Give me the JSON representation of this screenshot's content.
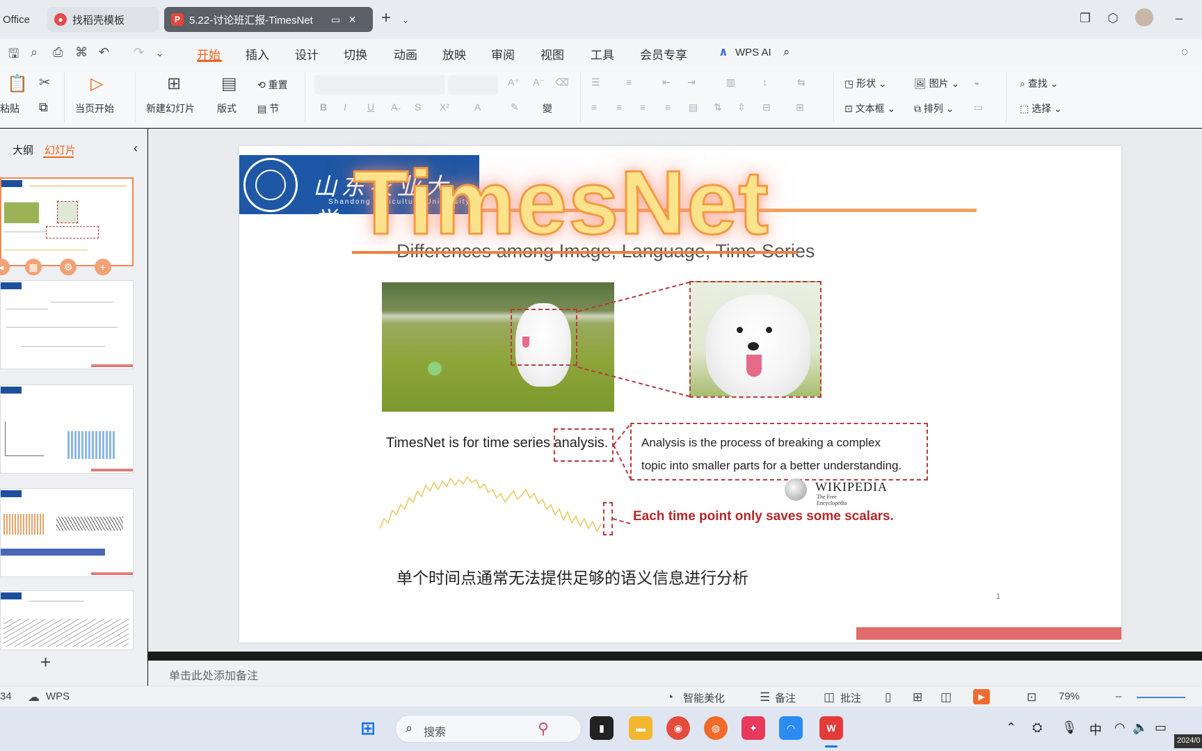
{
  "tabs": {
    "office": "Office",
    "template": "找稻壳模板",
    "document": "5.22-讨论班汇报-TimesNet"
  },
  "menu": {
    "items": [
      "开始",
      "插入",
      "设计",
      "切换",
      "动画",
      "放映",
      "审阅",
      "视图",
      "工具",
      "会员专享"
    ],
    "active": "开始",
    "wps_ai": "WPS AI"
  },
  "ribbon": {
    "paste": "粘贴",
    "play_current": "当页开始",
    "new_slide": "新建幻灯片",
    "layout": "版式",
    "reset": "重置",
    "section": "节",
    "shape": "形状",
    "picture": "图片",
    "textbox": "文本框",
    "arrange": "排列",
    "find": "查找",
    "select": "选择"
  },
  "left_panel": {
    "outline_tab": "大纲",
    "slides_tab": "幻灯片",
    "add_button": "+"
  },
  "slide": {
    "banner_cn": "山东农业大学",
    "banner_en": "Shandong Agriculture University",
    "title": "Differences among Image, Language, Time Series",
    "ts_sentence": "TimesNet is for time series analysis.",
    "definition_line1": "Analysis is the process of breaking a complex",
    "definition_line2": "topic into smaller parts for a better understanding.",
    "wiki_name": "WIKIPEDIA",
    "wiki_sub": "The Free Encyclopedia",
    "scalar_note": "Each time point only saves some scalars.",
    "cn_caption": "单个时间点通常无法提供足够的语义信息进行分析",
    "page_number": "1"
  },
  "overlay_title": "TimesNet",
  "notes_placeholder": "单击此处添加备注",
  "status": {
    "slide_counter": "34",
    "wps_label": "WPS",
    "beautify": "智能美化",
    "notes": "备注",
    "comments": "批注",
    "zoom": "79%"
  },
  "taskbar": {
    "search_placeholder": "搜索",
    "ime": "中",
    "date": "2024/0"
  },
  "colors": {
    "accent": "#e8651f",
    "banner_blue": "#1e57a6",
    "dashed_red": "#b93a3a",
    "scalar_red": "#b5262a",
    "overlay_fill": "#fbe38c"
  }
}
